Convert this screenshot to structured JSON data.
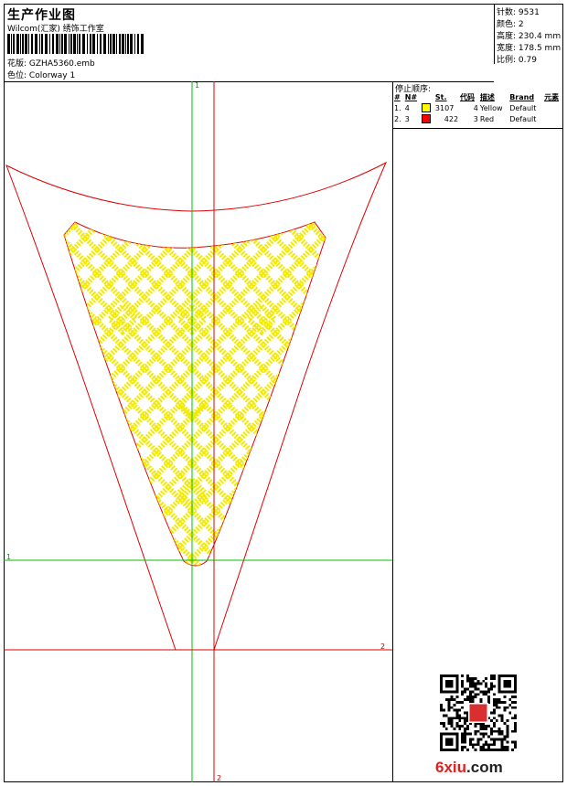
{
  "header": {
    "title": "生产作业图",
    "company": "Wilcom(汇家) 绣饰工作室",
    "design_label": "花版:",
    "design_value": "GZHA5360.emb",
    "colorway_label": "色位:",
    "colorway_value": "Colorway 1"
  },
  "stats": [
    {
      "label": "针数:",
      "value": "9531"
    },
    {
      "label": "颜色:",
      "value": "2"
    },
    {
      "label": "高度:",
      "value": "230.4 mm"
    },
    {
      "label": "宽度:",
      "value": "178.5 mm"
    },
    {
      "label": "比例:",
      "value": "0.79"
    }
  ],
  "stop_sequence": {
    "title": "停止顺序:",
    "columns": [
      "#",
      "N#",
      "St.",
      "代码",
      "描述",
      "Brand",
      "元素"
    ],
    "rows": [
      {
        "index": "1.",
        "needle": "4",
        "color": "#ffff00",
        "stitches": "3107",
        "code": "4",
        "desc": "Yellow",
        "brand": "Default"
      },
      {
        "index": "2.",
        "needle": "3",
        "color": "#ff0000",
        "stitches": "422",
        "code": "3",
        "desc": "Red",
        "brand": "Default"
      }
    ]
  },
  "guides": {
    "top_marker": "1",
    "left_marker": "1",
    "right_marker": "2",
    "bottom_marker": "2",
    "color_green": "#00c000",
    "color_red": "#e00000"
  },
  "colors": {
    "fill_yellow": "#ffff00",
    "outline_red": "#e00000"
  },
  "watermark": {
    "brand": "6xiu",
    "domain": ".com"
  }
}
